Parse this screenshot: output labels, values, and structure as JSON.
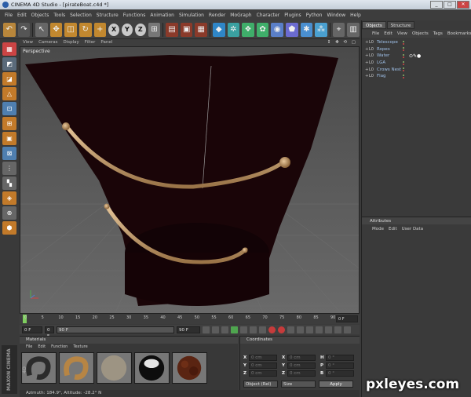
{
  "window": {
    "title": "CINEMA 4D Studio - [pirateBoat.c4d *]"
  },
  "menu": [
    "File",
    "Edit",
    "Objects",
    "Tools",
    "Selection",
    "Structure",
    "Functions",
    "Animation",
    "Simulation",
    "Render",
    "MoGraph",
    "Character",
    "Plugins",
    "Python",
    "Window",
    "Help"
  ],
  "toolbar": {
    "icons": [
      "undo-icon",
      "redo-icon",
      "live-select-icon",
      "move-icon",
      "scale-icon",
      "rotate-icon",
      "add-icon",
      "x-axis-icon",
      "y-axis-icon",
      "z-axis-icon",
      "coord-system-icon",
      "render-view-icon",
      "render-picture-viewer-icon",
      "render-settings-icon",
      "cube-icon",
      "bend-deformer-icon",
      "subdivision-icon",
      "array-icon",
      "camera-icon",
      "light-icon",
      "scene-icon",
      "environment-icon",
      "snap-icon",
      "layer-icon"
    ],
    "axis_labels": [
      "X",
      "Y",
      "Z"
    ]
  },
  "viewport": {
    "menu": [
      "View",
      "Cameras",
      "Display",
      "Filter",
      "Panel"
    ],
    "label": "Perspective",
    "nav_icons": "↕ ✥ ⟲ ▢"
  },
  "object_manager": {
    "tabs": [
      "Objects",
      "Structure"
    ],
    "menu": [
      "File",
      "Edit",
      "View",
      "Objects",
      "Tags",
      "Bookmarks"
    ],
    "objects": [
      {
        "name": "Telescope",
        "prefix": "L0"
      },
      {
        "name": "Ropes",
        "prefix": "L0"
      },
      {
        "name": "Water",
        "prefix": "L0"
      },
      {
        "name": "LGA",
        "prefix": "L0"
      },
      {
        "name": "Crows Nest",
        "prefix": "L0"
      },
      {
        "name": "Flag",
        "prefix": "L0"
      }
    ]
  },
  "attributes": {
    "title": "Attributes",
    "menu": [
      "Mode",
      "Edit",
      "User Data"
    ]
  },
  "timeline": {
    "ticks": [
      "0",
      "5",
      "10",
      "15",
      "20",
      "25",
      "30",
      "35",
      "40",
      "45",
      "50",
      "55",
      "60",
      "65",
      "70",
      "75",
      "80",
      "85",
      "90"
    ],
    "end_field": "0 F"
  },
  "transport": {
    "start": "0 F",
    "min": "0 F",
    "max": "90 F",
    "end": "90 F"
  },
  "materials": {
    "title": "Materials",
    "menu": [
      "File",
      "Edit",
      "Function",
      "Texture"
    ],
    "swatch_colors": [
      "#4a4a4a",
      "#a87a3c",
      "#9a9080",
      "#d8d8d8",
      "#5a2a14"
    ]
  },
  "coordinates": {
    "title": "Coordinates",
    "rows": [
      {
        "a": "X",
        "av": "0 cm",
        "b": "X",
        "bv": "0 cm",
        "c": "H",
        "cv": "0 °"
      },
      {
        "a": "Y",
        "av": "0 cm",
        "b": "Y",
        "bv": "0 cm",
        "c": "P",
        "cv": "0 °"
      },
      {
        "a": "Z",
        "av": "0 cm",
        "b": "Z",
        "bv": "0 cm",
        "c": "B",
        "cv": "0 °"
      }
    ],
    "mode": "Object (Rel)",
    "size_mode": "Size",
    "apply": "Apply"
  },
  "status": "Azimuth: 184.9°, Altitude: -28.2°  N",
  "branding": "MAXON CINEMA 4D",
  "watermark": "pxleyes.com",
  "colors": {
    "hull": "#1a0508",
    "rope": "#c9a070",
    "grid": "#6b6b6b"
  }
}
